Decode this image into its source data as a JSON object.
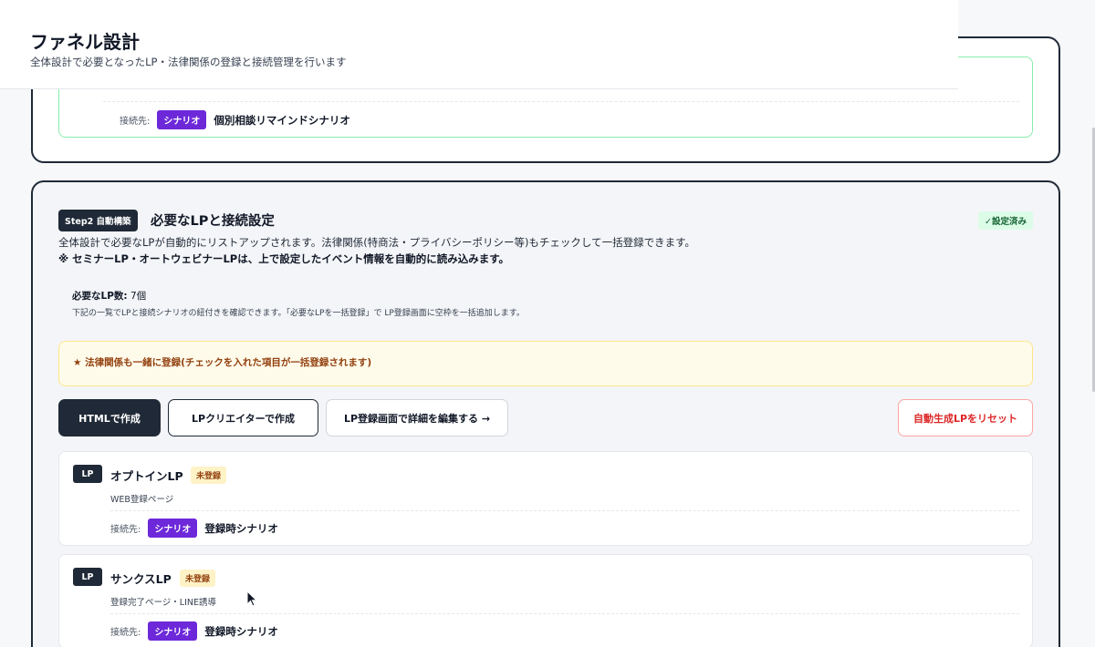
{
  "header": {
    "title": "ファネル設計",
    "subtitle": "全体設計で必要となったLP・法律関係の登録と接続管理を行います"
  },
  "top_card": {
    "connection_label": "接続先:",
    "scenario_badge": "シナリオ",
    "scenario_name": "個別相談リマインドシナリオ"
  },
  "step2": {
    "badge": "Step2 自動構築",
    "title": "必要なLPと接続設定",
    "status": "✓設定済み",
    "description": "全体設計で必要なLPが自動的にリストアップされます。法律関係(特商法・プライバシーポリシー等)もチェックして一括登録できます。",
    "note": "※ セミナーLP・オートウェビナーLPは、上で設定したイベント情報を自動的に読み込みます。",
    "required_label": "必要なLP数:",
    "required_count": "7個",
    "required_note": "下記の一覧でLPと接続シナリオの紐付きを確認できます。「必要なLPを一括登録」で LP登録画面に空枠を一括追加します。",
    "legal_text": "★ 法律関係も一緒に登録(チェックを入れた項目が一括登録されます)",
    "buttons": {
      "html": "HTMLで作成",
      "creator": "LPクリエイターで作成",
      "edit": "LP登録画面で詳細を編集する →",
      "reset": "自動生成LPをリセット"
    },
    "lp_items": [
      {
        "tag": "LP",
        "name": "オプトインLP",
        "status": "未登録",
        "description": "WEB登録ページ",
        "connection_label": "接続先:",
        "scenario_badge": "シナリオ",
        "scenario_name": "登録時シナリオ"
      },
      {
        "tag": "LP",
        "name": "サンクスLP",
        "status": "未登録",
        "description": "登録完了ページ・LINE誘導",
        "connection_label": "接続先:",
        "scenario_badge": "シナリオ",
        "scenario_name": "登録時シナリオ"
      }
    ]
  }
}
